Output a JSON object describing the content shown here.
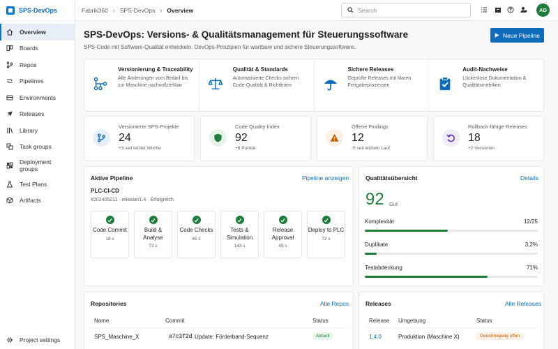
{
  "app": {
    "name": "SPS-DevOps"
  },
  "sidebar": {
    "items": [
      {
        "label": "Overview",
        "icon": "home-icon"
      },
      {
        "label": "Boards",
        "icon": "boards-icon"
      },
      {
        "label": "Repos",
        "icon": "repos-icon"
      },
      {
        "label": "Pipelines",
        "icon": "pipelines-icon"
      },
      {
        "label": "Environments",
        "icon": "environments-icon"
      },
      {
        "label": "Releases",
        "icon": "releases-icon"
      },
      {
        "label": "Library",
        "icon": "library-icon"
      },
      {
        "label": "Task groups",
        "icon": "task-groups-icon"
      },
      {
        "label": "Deployment groups",
        "icon": "deployment-groups-icon"
      },
      {
        "label": "Test Plans",
        "icon": "test-plans-icon"
      },
      {
        "label": "Artifacts",
        "icon": "artifacts-icon"
      }
    ],
    "footer": "Project settings"
  },
  "breadcrumb": [
    "Fabrik360",
    "SPS-DevOps",
    "Overview"
  ],
  "search": {
    "placeholder": "Search"
  },
  "user": {
    "initials": "AD"
  },
  "header": {
    "title": "SPS-DevOps: Versions- & Qualitätsmanagement für Steuerungssoftware",
    "subtitle": "SPS-Code mit Software-Qualität entwickeln. DevOps-Prinzipien für wartbare und sichere Steuerungssoftware.",
    "new_pipeline": "Neue Pipeline"
  },
  "features": [
    {
      "title": "Versionierung & Traceability",
      "desc": "Alle Änderungen vom Bedarf bis zur Maschine nachvollziehbar",
      "icon": "git-branch-icon"
    },
    {
      "title": "Qualität & Standards",
      "desc": "Automatisierte Checks sichern Code-Qualität & Richtlinien",
      "icon": "scales-icon"
    },
    {
      "title": "Sichere Releases",
      "desc": "Geprüfte Releases mit klaren Freigabeprozessen",
      "icon": "umbrella-icon"
    },
    {
      "title": "Audit-Nachweise",
      "desc": "Lückenlose Dokumentation & Qualitätsmetriken",
      "icon": "clipboard-check-icon"
    }
  ],
  "stats": [
    {
      "label": "Versionierte SPS-Projekte",
      "value": "24",
      "sub": "+3 seit letzter Woche",
      "icon": "branch-icon"
    },
    {
      "label": "Code Quality Index",
      "value": "92",
      "sub": "+8 Punkte",
      "icon": "shield-icon"
    },
    {
      "label": "Offene Findings",
      "value": "12",
      "sub": "-5 seit letztem Lauf",
      "icon": "warning-icon"
    },
    {
      "label": "Rollback-fähige Releases",
      "value": "18",
      "sub": "+2 Versionen",
      "icon": "rollback-icon"
    }
  ],
  "pipeline": {
    "title": "Aktive Pipeline",
    "link": "Pipeline anzeigen",
    "name": "PLC-CI-CD",
    "meta": "#202405211 · release/1.4 · Erfolgreich",
    "stages": [
      {
        "name": "Code Commit",
        "dur": "18 s"
      },
      {
        "name": "Build & Analyse",
        "dur": "72 s"
      },
      {
        "name": "Code Checks",
        "dur": "45 s"
      },
      {
        "name": "Tests & Simulation",
        "dur": "143 s"
      },
      {
        "name": "Release Approval",
        "dur": "45 s"
      },
      {
        "name": "Deploy to PLC",
        "dur": "72 s"
      }
    ]
  },
  "quality": {
    "title": "Qualitätsübersicht",
    "link": "Details",
    "score": "92",
    "grade": "Gut",
    "metrics": [
      {
        "label": "Komplexität",
        "value": "12/25",
        "fraction": 0.48
      },
      {
        "label": "Duplikate",
        "value": "3,2%",
        "fraction": 0.07
      },
      {
        "label": "Testabdeckung",
        "value": "71%",
        "fraction": 0.71
      }
    ]
  },
  "repos": {
    "title": "Repositories",
    "link": "Alle Repos",
    "headers": [
      "Name",
      "Commit",
      "Status"
    ],
    "rows": [
      {
        "name": "SPS_Maschine_X",
        "hash": "a7c3f2d",
        "msg": "Update: Förderband-Sequenz",
        "status": "Aktuell"
      }
    ]
  },
  "releases": {
    "title": "Releases",
    "link": "Alle Releases",
    "headers": [
      "Release",
      "Umgebung",
      "Status"
    ],
    "rows": [
      {
        "release": "1.4.0",
        "env": "Produktion (Maschine X)",
        "status": "Genehmigung offen"
      }
    ]
  },
  "colors": {
    "accent": "#0f6cbd",
    "success": "#1e7d3b",
    "warning": "#c25c00"
  }
}
